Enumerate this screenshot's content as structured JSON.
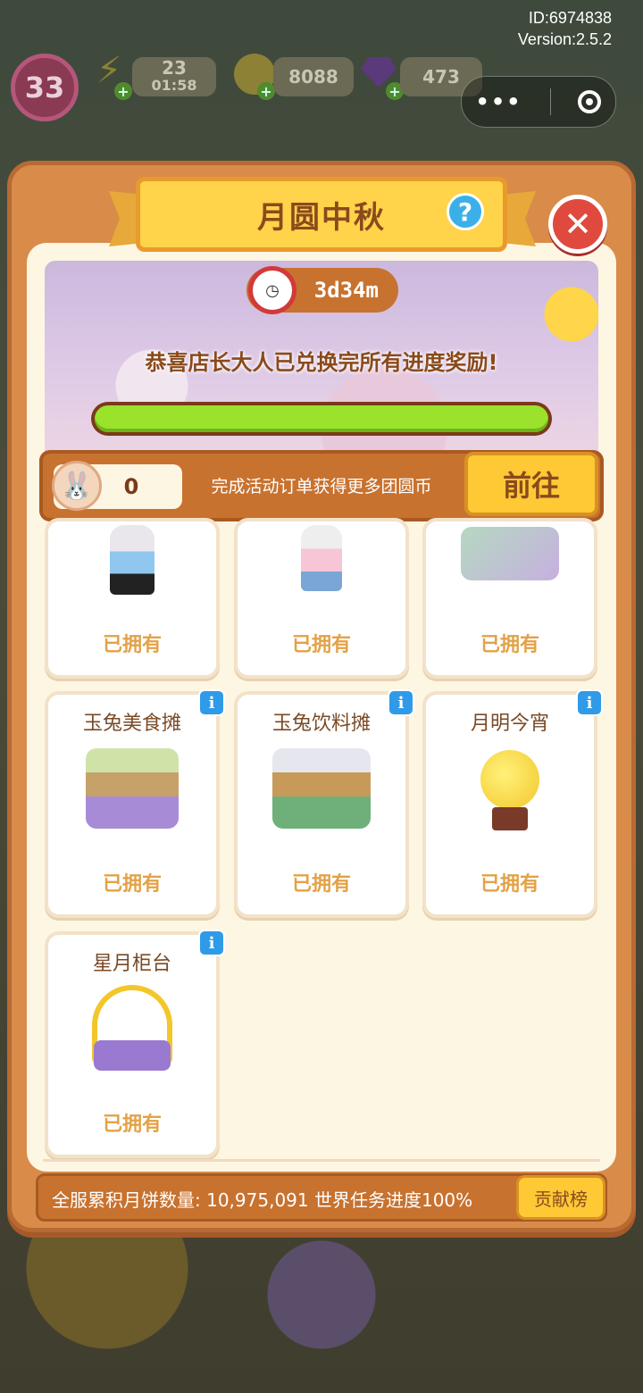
{
  "top_info": {
    "id": "ID:6974838",
    "version": "Version:2.5.2"
  },
  "hud": {
    "level": "33",
    "energy": "23",
    "energy_timer": "01:58",
    "coins": "8088",
    "gems": "473"
  },
  "event": {
    "title": "月圆中秋",
    "timer": "3d34m",
    "message": "恭喜店长大人已兑换完所有进度奖励!",
    "progress": 1.0,
    "coin_count": "0",
    "coin_hint": "完成活动订单获得更多团圆币",
    "go_label": "前往"
  },
  "rewards": [
    {
      "name": "",
      "status": "已拥有",
      "has_info": false
    },
    {
      "name": "",
      "status": "已拥有",
      "has_info": false
    },
    {
      "name": "",
      "status": "已拥有",
      "has_info": false
    },
    {
      "name": "玉兔美食摊",
      "status": "已拥有",
      "has_info": true
    },
    {
      "name": "玉兔饮料摊",
      "status": "已拥有",
      "has_info": true
    },
    {
      "name": "月明今宵",
      "status": "已拥有",
      "has_info": true
    },
    {
      "name": "星月柜台",
      "status": "已拥有",
      "has_info": true
    }
  ],
  "footer": {
    "stat_label": "全服累积月饼数量:",
    "stat_value": "10,975,091",
    "world_task": "世界任务进度100%",
    "rank_label": "贡献榜"
  },
  "colors": {
    "panel": "#d98b4a",
    "accent": "#ffc936",
    "progress": "#9be22c",
    "info": "#2f9be8",
    "close": "#e04a3e"
  }
}
